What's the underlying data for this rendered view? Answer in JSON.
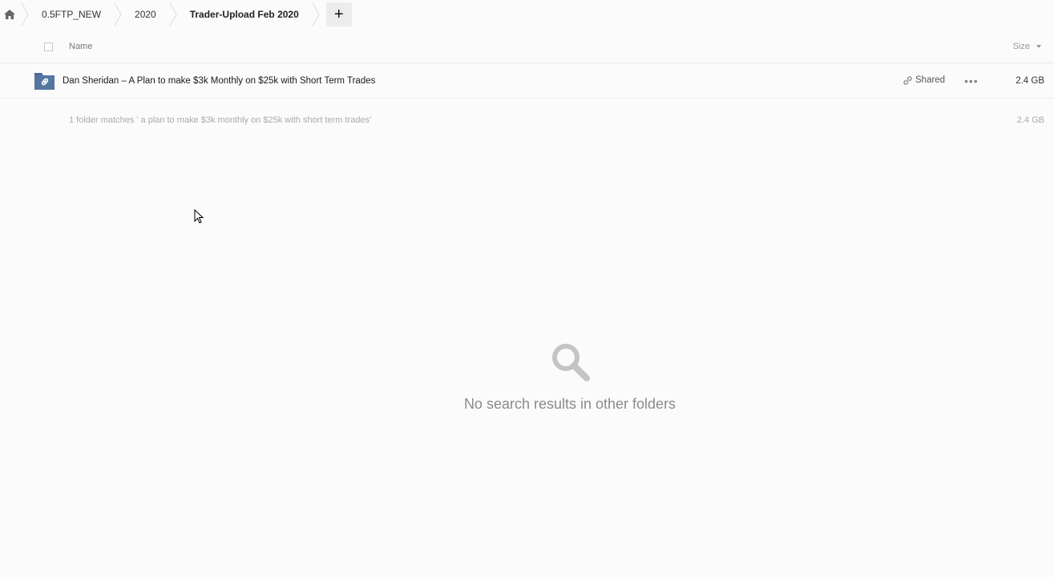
{
  "breadcrumb": {
    "home_icon": "home-icon",
    "items": [
      "0.5FTP_NEW",
      "2020",
      "Trader-Upload Feb 2020"
    ],
    "add_label": "+"
  },
  "list_header": {
    "name_label": "Name",
    "size_label": "Size"
  },
  "rows": [
    {
      "name": "Dan Sheridan – A Plan to make $3k Monthly on $25k with Short Term Trades",
      "icon": "shared-folder-icon",
      "shared_label": "Shared",
      "more_label": "•••",
      "size": "2.4 GB"
    }
  ],
  "summary": {
    "text": "1 folder matches ' a plan to make $3k monthly on $25k with short term trades'",
    "size": "2.4 GB"
  },
  "empty_state": {
    "icon": "search-icon",
    "text": "No search results in other folders"
  },
  "colors": {
    "folder": "#4a6a9a",
    "background": "#fbfbfb"
  }
}
